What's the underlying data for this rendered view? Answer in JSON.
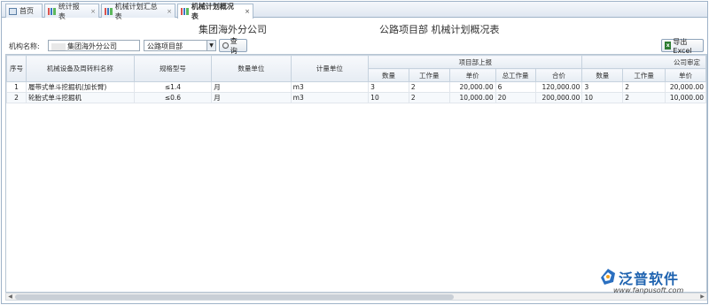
{
  "tabs": [
    {
      "label": "首页",
      "icon": "home-icon"
    },
    {
      "label": "统计报表",
      "icon": "chart-icon"
    },
    {
      "label": "机械计划汇总表",
      "icon": "chart-icon"
    },
    {
      "label": "机械计划概况表",
      "icon": "chart-icon"
    }
  ],
  "titles": {
    "company": "集团海外分公司",
    "report": "公路项目部 机械计划概况表"
  },
  "filters": {
    "org_label": "机构名称:",
    "org_value": "集团海外分公司",
    "dept_value": "公路项目部",
    "search_label": "查询",
    "export_label": "导出Excel"
  },
  "table": {
    "headers": {
      "seq": "序号",
      "name": "机械设备及周转料名称",
      "spec": "规格型号",
      "qty_unit": "数量单位",
      "measure_unit": "计量单位",
      "group_project": "项目部上报",
      "group_company": "公司审定",
      "qty": "数量",
      "workload": "工作量",
      "unit_price": "单价",
      "total_work": "总工作量",
      "total_price": "合价"
    },
    "rows": [
      {
        "seq": "1",
        "name": "履带式单斗挖掘机(加长臂)",
        "spec": "≤1.4",
        "qty_unit": "月",
        "measure_unit": "m3",
        "qty": "3",
        "workload": "2",
        "unit_price": "20,000.00",
        "total_work": "6",
        "total_price": "120,000.00",
        "c_qty": "3",
        "c_workload": "2",
        "c_unit_price": "20,000.00"
      },
      {
        "seq": "2",
        "name": "轮胎式单斗挖掘机",
        "spec": "≤0.6",
        "qty_unit": "月",
        "measure_unit": "m3",
        "qty": "10",
        "workload": "2",
        "unit_price": "10,000.00",
        "total_work": "20",
        "total_price": "200,000.00",
        "c_qty": "10",
        "c_workload": "2",
        "c_unit_price": "10,000.00"
      }
    ]
  },
  "logo": {
    "brand": "泛普软件",
    "url": "www.fanpusoft.com"
  },
  "colors": {
    "brand": "#1f63b0",
    "header_bg": "#e6ecf3",
    "border": "#9fb3c8"
  }
}
